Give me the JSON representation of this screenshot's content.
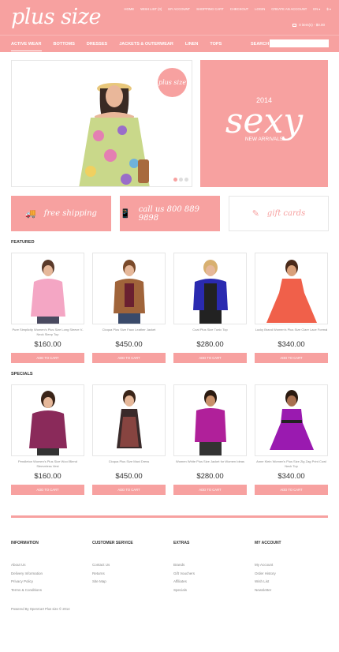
{
  "header": {
    "logo": "plus size",
    "top_links": [
      "HOME",
      "WISH LIST (0)",
      "MY ACCOUNT",
      "SHOPPING CART",
      "CHECKOUT",
      "LOGIN",
      "CREATE AN ACCOUNT",
      "EN ▾",
      "$ ▾"
    ],
    "cart": "0 item(s) - $0.00"
  },
  "nav": {
    "items": [
      "ACTIVE WEAR",
      "BOTTOMS",
      "DRESSES",
      "JACKETS & OUTERWEAR",
      "LINEN",
      "TOPS"
    ],
    "search_label": "SEARCH",
    "search_placeholder": ""
  },
  "slider": {
    "badge": "plus size"
  },
  "promo": {
    "year": "2014",
    "headline": "sexy",
    "sub": "NEW ARRIVALS"
  },
  "features": [
    {
      "label": "free shipping",
      "icon": "truck-icon"
    },
    {
      "label": "call us 800 889 9898",
      "icon": "phone-icon"
    },
    {
      "label": "gift cards",
      "icon": "gift-icon"
    }
  ],
  "featured": {
    "title": "FEATURED",
    "products": [
      {
        "name": "Pure Simplicity Women's Plus Size Long Sleeve V-Neck Sleep Top",
        "price": "$160.00",
        "button": "ADD TO CART"
      },
      {
        "name": "Cloqua Plus Size Faux Leather Jacket",
        "price": "$450.00",
        "button": "ADD TO CART"
      },
      {
        "name": "Coat Plus Size Tunic Top",
        "price": "$280.00",
        "button": "ADD TO CART"
      },
      {
        "name": "Lucky Brand Women's Plus Size Clare Lace Formal",
        "price": "$340.00",
        "button": "ADD TO CART"
      }
    ]
  },
  "specials": {
    "title": "SPECIALS",
    "products": [
      {
        "name": "Pendleton Women's Plus Size Wool Blend Sleeveless Vest",
        "price": "$160.00",
        "button": "ADD TO CART"
      },
      {
        "name": "Cloqua Plus Size Maxi Dress",
        "price": "$450.00",
        "button": "ADD TO CART"
      },
      {
        "name": "Women White Plus Size Jacket for Women Ideas",
        "price": "$280.00",
        "button": "ADD TO CART"
      },
      {
        "name": "Anne Klein Women's Plus Size Zig Zag Print Cowl Neck Top",
        "price": "$340.00",
        "button": "ADD TO CART"
      }
    ]
  },
  "footer": {
    "columns": [
      {
        "title": "INFORMATION",
        "links": [
          "About Us",
          "Delivery Information",
          "Privacy Policy",
          "Terms & Conditions"
        ]
      },
      {
        "title": "CUSTOMER SERVICE",
        "links": [
          "Contact Us",
          "Returns",
          "Site Map"
        ]
      },
      {
        "title": "EXTRAS",
        "links": [
          "Brands",
          "Gift Vouchers",
          "Affiliates",
          "Specials"
        ]
      },
      {
        "title": "MY ACCOUNT",
        "links": [
          "My Account",
          "Order History",
          "Wish List",
          "Newsletter"
        ]
      }
    ],
    "powered": "Powered By OpenCart Plus size © 2014"
  },
  "colors": {
    "accent": "#f7a1a0"
  }
}
